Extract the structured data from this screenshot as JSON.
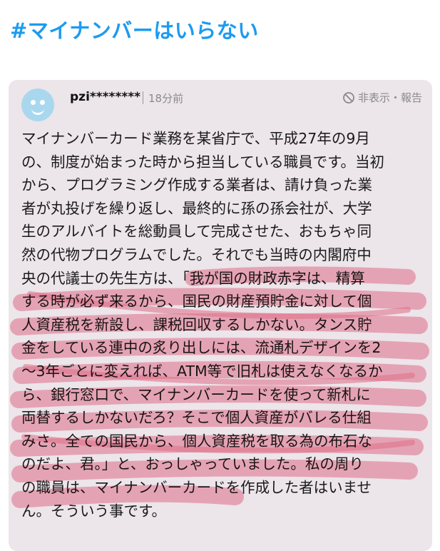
{
  "hashtag": "#マイナンバーはいらない",
  "comment": {
    "username": "pzi********",
    "time": "18分前",
    "hide_report": "非表示・報告",
    "icons": [
      "avatar-face-icon",
      "prohibit-icon"
    ],
    "lines": [
      "マイナンバーカード業務を某省庁で、平成27年の9月",
      "の、制度が始まった時から担当している職員です。当初",
      "から、プログラミング作成する業者は、請け負った業",
      "者が丸投げを繰り返し、最終的に孫の孫会社が、大学",
      "生のアルバイトを総動員して完成させた、おもちゃ同",
      "然の代物プログラムでした。それでも当時の内閣府中",
      "央の代議士の先生方は、「我が国の財政赤字は、精算",
      "する時が必ず来るから、国民の財産預貯金に対して個",
      "人資産税を新設し、課税回収するしかない。タンス貯",
      "金をしている連中の炙り出しには、流通札デザインを2",
      "〜3年ごとに変えれば、ATM等で旧札は使えなくなるか",
      "ら、銀行窓口で、マイナンバーカードを使って新札に",
      "両替するしかないだろ？そこで個人資産がバレる仕組",
      "みさ。全ての国民から、個人資産税を取る為の布石な",
      "のだよ、君。」と、おっしゃっていました。私の周り",
      "の職員は、マイナンバーカードを作成した者はいませ",
      "ん。そういう事です。"
    ]
  },
  "colors": {
    "hashtag": "#1d9bf0",
    "card_background": "#ece5ea",
    "avatar": "#a9d8ee",
    "highlight": "#f07a93"
  }
}
